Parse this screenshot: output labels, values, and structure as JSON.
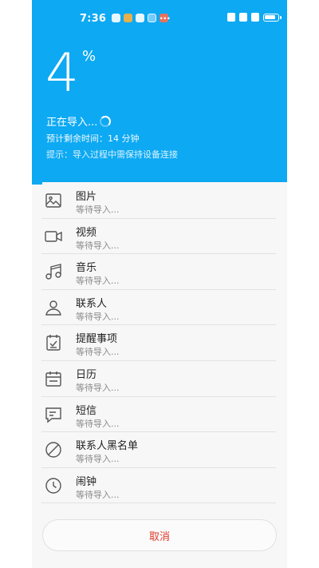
{
  "colors": {
    "accent": "#0da9f3",
    "cancel": "#e0392b"
  },
  "status_bar": {
    "time": "7:36",
    "more": "···"
  },
  "header": {
    "percent": "4",
    "percent_sign": "%",
    "status": "正在导入...",
    "remaining": "预计剩余时间：14 分钟",
    "tip": "提示：导入过程中需保持设备连接",
    "progress_fraction": 0.04
  },
  "items": [
    {
      "icon": "image-icon",
      "title": "图片",
      "sub": "等待导入..."
    },
    {
      "icon": "video-icon",
      "title": "视频",
      "sub": "等待导入..."
    },
    {
      "icon": "music-icon",
      "title": "音乐",
      "sub": "等待导入..."
    },
    {
      "icon": "contact-icon",
      "title": "联系人",
      "sub": "等待导入..."
    },
    {
      "icon": "reminder-icon",
      "title": "提醒事项",
      "sub": "等待导入..."
    },
    {
      "icon": "calendar-icon",
      "title": "日历",
      "sub": "等待导入..."
    },
    {
      "icon": "message-icon",
      "title": "短信",
      "sub": "等待导入..."
    },
    {
      "icon": "blocklist-icon",
      "title": "联系人黑名单",
      "sub": "等待导入..."
    },
    {
      "icon": "clock-icon",
      "title": "闹钟",
      "sub": "等待导入..."
    }
  ],
  "cancel_label": "取消"
}
